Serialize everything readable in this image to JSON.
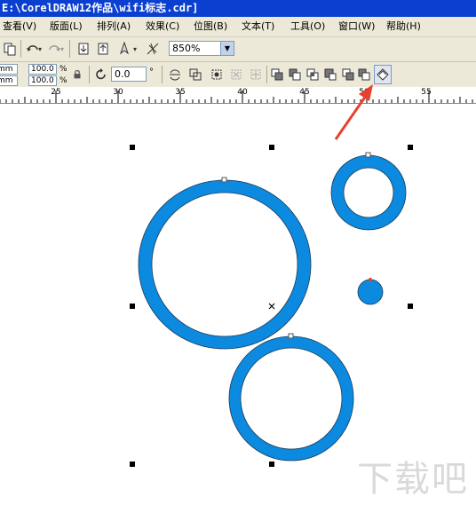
{
  "window": {
    "title": "E:\\CorelDRAW12作品\\wifi标志.cdr]"
  },
  "menu": [
    {
      "label": "查看(V)"
    },
    {
      "label": "版面(L)"
    },
    {
      "label": "排列(A)"
    },
    {
      "label": "效果(C)"
    },
    {
      "label": "位图(B)"
    },
    {
      "label": "文本(T)"
    },
    {
      "label": "工具(O)"
    },
    {
      "label": "窗口(W)"
    },
    {
      "label": "帮助(H)"
    }
  ],
  "toolbar": {
    "zoom": "850%"
  },
  "propbar": {
    "pos_x_unit": "mm",
    "pos_y_unit": "mm",
    "scale_x": "100.0",
    "scale_y": "100.0",
    "scale_unit": "%",
    "angle": "0.0",
    "angle_unit": "°"
  },
  "ruler": {
    "labels": [
      "25",
      "30",
      "35",
      "40",
      "45",
      "50",
      "55"
    ]
  },
  "watermark": "下载吧",
  "colors": {
    "ring_fill": "#0b8ae0",
    "arrow": "#e8402e",
    "titlebar": "#0b3fd0"
  }
}
